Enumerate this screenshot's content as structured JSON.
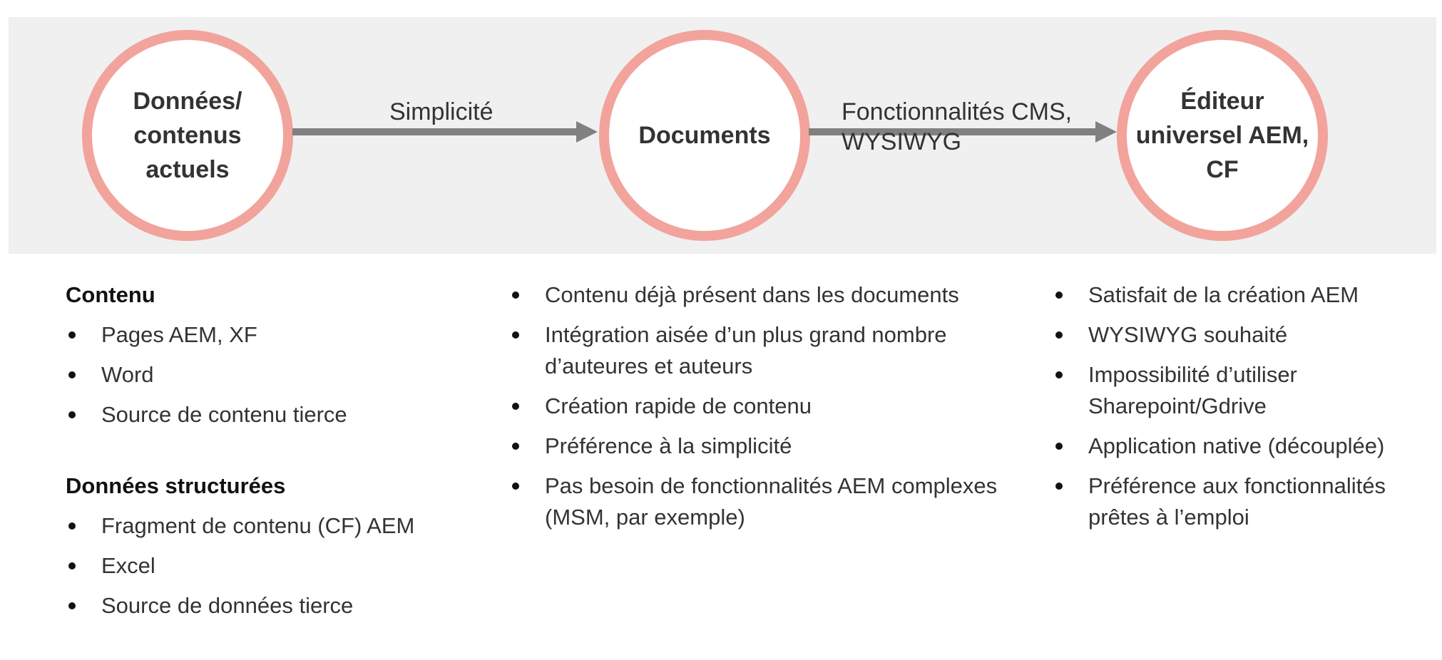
{
  "flow": {
    "nodes": [
      {
        "label": "Données/\ncontenus\nactuels"
      },
      {
        "label": "Documents"
      },
      {
        "label": "Éditeur\nuniversel AEM,\nCF"
      }
    ],
    "edges": [
      {
        "label": "Simplicité"
      },
      {
        "label": "Fonctionnalités CMS,\nWYSIWYG"
      }
    ]
  },
  "columns": {
    "current": {
      "sections": [
        {
          "title": "Contenu",
          "items": [
            "Pages AEM, XF",
            "Word",
            "Source de contenu tierce"
          ]
        },
        {
          "title": "Données structurées",
          "items": [
            "Fragment de contenu (CF) AEM",
            "Excel",
            "Source de données tierce"
          ]
        }
      ]
    },
    "documents": {
      "items": [
        "Contenu déjà présent dans les documents",
        "Intégration aisée d’un plus grand nombre\nd’auteures et auteurs",
        "Création rapide de contenu",
        "Préférence à la simplicité",
        "Pas besoin de fonctionnalités AEM complexes\n(MSM, par exemple)"
      ]
    },
    "editor": {
      "items": [
        "Satisfait de la création AEM",
        "WYSIWYG souhaité",
        "Impossibilité d’utiliser\nSharepoint/Gdrive",
        "Application native (découplée)",
        "Préférence aux fonctionnalités\nprêtes à l’emploi"
      ]
    }
  },
  "colors": {
    "node_border": "#f2a39c",
    "banner_background": "#f0f0f0",
    "arrow": "#808080"
  }
}
